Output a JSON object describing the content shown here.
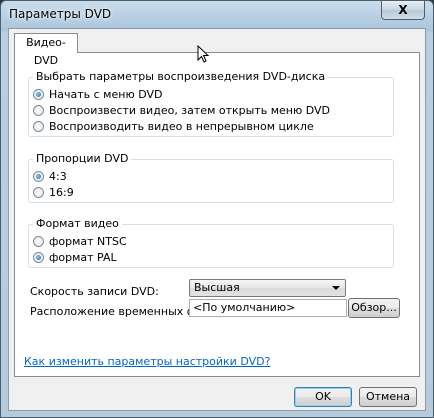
{
  "window": {
    "title": "Параметры DVD",
    "close_glyph": "X"
  },
  "tabs": [
    {
      "label": "Видео-DVD",
      "selected": true
    }
  ],
  "playback_group": {
    "legend": "Выбрать параметры воспроизведения DVD-диска",
    "options": [
      {
        "label": "Начать с меню DVD",
        "selected": true
      },
      {
        "label": "Воспроизвести видео, затем открыть меню DVD",
        "selected": false
      },
      {
        "label": "Воспроизводить видео в непрерывном цикле",
        "selected": false
      }
    ]
  },
  "aspect_group": {
    "legend": "Пропорции DVD",
    "options": [
      {
        "label": "4:3",
        "selected": true
      },
      {
        "label": "16:9",
        "selected": false
      }
    ]
  },
  "format_group": {
    "legend": "Формат видео",
    "options": [
      {
        "label": "формат NTSC",
        "selected": false
      },
      {
        "label": "формат PAL",
        "selected": true
      }
    ]
  },
  "burn_speed": {
    "label": "Скорость записи DVD:",
    "value": "Высшая"
  },
  "temp_location": {
    "label": "Расположение временных файлов:",
    "value": "<По умолчанию>",
    "browse_label": "Обзор..."
  },
  "help_link": "Как изменить параметры настройки DVD?",
  "footer": {
    "ok_label": "OK",
    "cancel_label": "Отмена"
  }
}
